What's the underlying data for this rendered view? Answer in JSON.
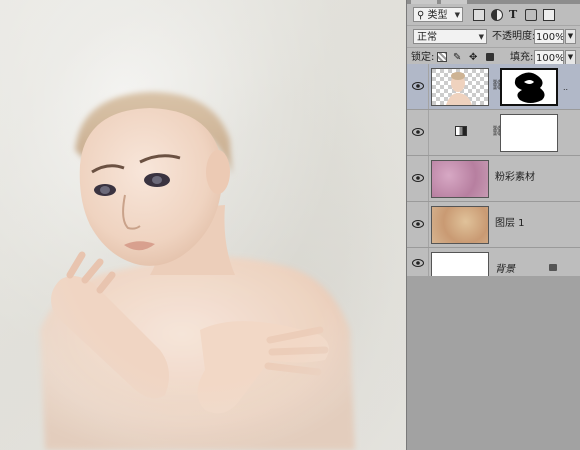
{
  "layers_panel": {
    "filter": {
      "label": "类型",
      "icon": "search-icon"
    },
    "filter_icons": [
      "image-filter-icon",
      "adjustment-filter-icon",
      "text-filter-icon",
      "shape-filter-icon",
      "smart-object-filter-icon"
    ],
    "blend_mode": "正常",
    "opacity": {
      "label": "不透明度:",
      "value": "100%"
    },
    "lock": {
      "label": "锁定:",
      "icons": [
        "lock-transparent-icon",
        "lock-paint-icon",
        "lock-move-icon",
        "lock-all-icon"
      ]
    },
    "fill": {
      "label": "填充:",
      "value": "100%"
    },
    "layers": [
      {
        "name": "",
        "visible": true,
        "selected": true,
        "thumb": "portrait",
        "mask": "black-white-mask"
      },
      {
        "name": "",
        "visible": true,
        "selected": false,
        "thumb": "adjustment",
        "mask": "white"
      },
      {
        "name": "粉彩素材",
        "visible": true,
        "selected": false,
        "thumb": "pink-texture"
      },
      {
        "name": "图层 1",
        "visible": true,
        "selected": false,
        "thumb": "beige-texture"
      },
      {
        "name": "背景",
        "visible": true,
        "selected": false,
        "thumb": "white",
        "locked": true
      }
    ]
  },
  "colors": {
    "canvas_bg": "#e6e5e0",
    "panel_bg": "#bdbdbd",
    "selection": "#b1b8c8",
    "skin": "#f1d8c6"
  }
}
